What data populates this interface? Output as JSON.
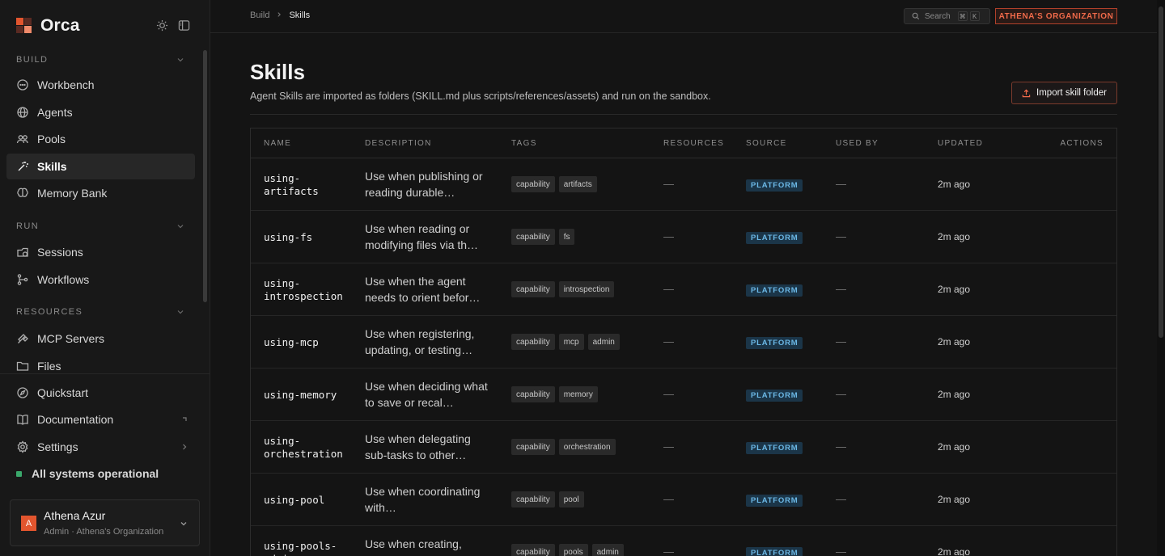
{
  "brand": {
    "name": "Orca",
    "colors": {
      "accent": "#e2552e"
    }
  },
  "sidebar": {
    "sections": [
      {
        "label": "BUILD",
        "items": [
          {
            "label": "Workbench",
            "icon": "chat-bubble-icon"
          },
          {
            "label": "Agents",
            "icon": "globe-icon"
          },
          {
            "label": "Pools",
            "icon": "users-icon"
          },
          {
            "label": "Skills",
            "icon": "magic-wand-icon",
            "active": true
          },
          {
            "label": "Memory Bank",
            "icon": "brain-icon"
          }
        ]
      },
      {
        "label": "RUN",
        "items": [
          {
            "label": "Sessions",
            "icon": "sessions-icon"
          },
          {
            "label": "Workflows",
            "icon": "workflow-icon"
          }
        ]
      },
      {
        "label": "RESOURCES",
        "items": [
          {
            "label": "MCP Servers",
            "icon": "plug-icon"
          },
          {
            "label": "Files",
            "icon": "folder-icon"
          }
        ]
      }
    ],
    "bottom_items": [
      {
        "label": "Quickstart",
        "icon": "compass-icon"
      },
      {
        "label": "Documentation",
        "icon": "book-icon"
      },
      {
        "label": "Settings",
        "icon": "gear-icon"
      }
    ],
    "status": "All systems operational",
    "user": {
      "initial": "A",
      "name": "Athena Azur",
      "subtitle": "Admin · Athena's Organization"
    }
  },
  "topbar": {
    "breadcrumb": [
      "Build",
      "Skills"
    ],
    "search_label": "Search",
    "search_keys": [
      "⌘",
      "K"
    ],
    "org": "ATHENA'S ORGANIZATION"
  },
  "main": {
    "title": "Skills",
    "subtitle": "Agent Skills are imported as folders (SKILL.md plus scripts/references/assets) and run on the sandbox.",
    "import_label": "Import skill folder"
  },
  "table": {
    "columns": [
      "NAME",
      "DESCRIPTION",
      "TAGS",
      "RESOURCES",
      "SOURCE",
      "USED BY",
      "UPDATED",
      "ACTIONS"
    ],
    "rows": [
      {
        "name": "using-\nartifacts",
        "description": "Use when publishing or reading durable…",
        "tags": [
          "capability",
          "artifacts"
        ],
        "resources": "—",
        "source": "PLATFORM",
        "used_by": "—",
        "updated": "2m ago"
      },
      {
        "name": "using-fs",
        "description": "Use when reading or modifying files via th…",
        "tags": [
          "capability",
          "fs"
        ],
        "resources": "—",
        "source": "PLATFORM",
        "used_by": "—",
        "updated": "2m ago"
      },
      {
        "name": "using-\nintrospection",
        "description": "Use when the agent needs to orient befor…",
        "tags": [
          "capability",
          "introspection"
        ],
        "resources": "—",
        "source": "PLATFORM",
        "used_by": "—",
        "updated": "2m ago"
      },
      {
        "name": "using-mcp",
        "description": "Use when registering, updating, or testing…",
        "tags": [
          "capability",
          "mcp",
          "admin"
        ],
        "resources": "—",
        "source": "PLATFORM",
        "used_by": "—",
        "updated": "2m ago"
      },
      {
        "name": "using-memory",
        "description": "Use when deciding what to save or recal…",
        "tags": [
          "capability",
          "memory"
        ],
        "resources": "—",
        "source": "PLATFORM",
        "used_by": "—",
        "updated": "2m ago"
      },
      {
        "name": "using-\norchestration",
        "description": "Use when delegating sub-tasks to other…",
        "tags": [
          "capability",
          "orchestration"
        ],
        "resources": "—",
        "source": "PLATFORM",
        "used_by": "—",
        "updated": "2m ago"
      },
      {
        "name": "using-pool",
        "description": "Use when coordinating with…",
        "tags": [
          "capability",
          "pool"
        ],
        "resources": "—",
        "source": "PLATFORM",
        "used_by": "—",
        "updated": "2m ago"
      },
      {
        "name": "using-pools-\nadmin",
        "description": "Use when creating, registering or updating…",
        "tags": [
          "capability",
          "pools",
          "admin"
        ],
        "resources": "—",
        "source": "PLATFORM",
        "used_by": "—",
        "updated": "2m ago"
      }
    ]
  }
}
